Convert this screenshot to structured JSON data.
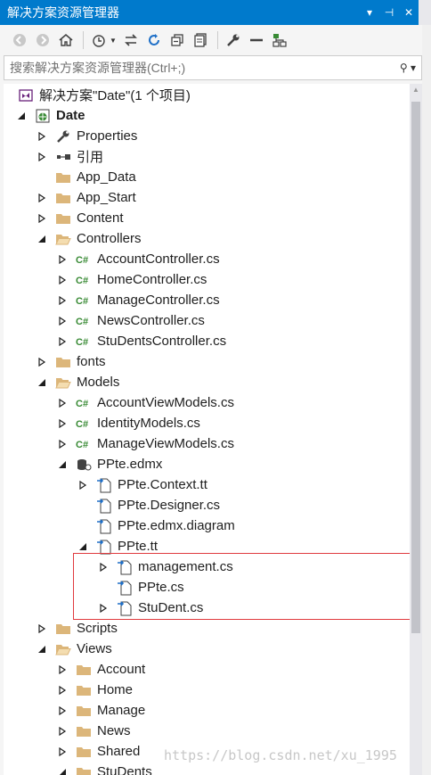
{
  "window": {
    "title": "解决方案资源管理器",
    "pin_glyph": "▾ ⊣ ✕"
  },
  "search": {
    "placeholder": "搜索解决方案资源管理器(Ctrl+;)"
  },
  "solution": {
    "label": "解决方案\"Date\"(1 个项目)"
  },
  "tree": [
    {
      "label": "Date",
      "bold": true,
      "indent": 1,
      "arrow": "open",
      "icon": "project-icon"
    },
    {
      "label": "Properties",
      "indent": 2,
      "arrow": "closed",
      "icon": "wrench-icon"
    },
    {
      "label": "引用",
      "indent": 2,
      "arrow": "closed",
      "icon": "references-icon"
    },
    {
      "label": "App_Data",
      "indent": 2,
      "arrow": "none",
      "icon": "folder-icon"
    },
    {
      "label": "App_Start",
      "indent": 2,
      "arrow": "closed",
      "icon": "folder-icon"
    },
    {
      "label": "Content",
      "indent": 2,
      "arrow": "closed",
      "icon": "folder-icon"
    },
    {
      "label": "Controllers",
      "indent": 2,
      "arrow": "open",
      "icon": "folder-open-icon"
    },
    {
      "label": "AccountController.cs",
      "indent": 3,
      "arrow": "closed",
      "icon": "csharp-icon"
    },
    {
      "label": "HomeController.cs",
      "indent": 3,
      "arrow": "closed",
      "icon": "csharp-icon"
    },
    {
      "label": "ManageController.cs",
      "indent": 3,
      "arrow": "closed",
      "icon": "csharp-icon"
    },
    {
      "label": "NewsController.cs",
      "indent": 3,
      "arrow": "closed",
      "icon": "csharp-icon"
    },
    {
      "label": "StuDentsController.cs",
      "indent": 3,
      "arrow": "closed",
      "icon": "csharp-icon"
    },
    {
      "label": "fonts",
      "indent": 2,
      "arrow": "closed",
      "icon": "folder-icon"
    },
    {
      "label": "Models",
      "indent": 2,
      "arrow": "open",
      "icon": "folder-open-icon"
    },
    {
      "label": "AccountViewModels.cs",
      "indent": 3,
      "arrow": "closed",
      "icon": "csharp-icon"
    },
    {
      "label": "IdentityModels.cs",
      "indent": 3,
      "arrow": "closed",
      "icon": "csharp-icon"
    },
    {
      "label": "ManageViewModels.cs",
      "indent": 3,
      "arrow": "closed",
      "icon": "csharp-icon"
    },
    {
      "label": "PPte.edmx",
      "indent": 3,
      "arrow": "open",
      "icon": "edmx-icon"
    },
    {
      "label": "PPte.Context.tt",
      "indent": 4,
      "arrow": "closed",
      "icon": "linked-file-icon"
    },
    {
      "label": "PPte.Designer.cs",
      "indent": 4,
      "arrow": "none",
      "icon": "linked-file-icon"
    },
    {
      "label": "PPte.edmx.diagram",
      "indent": 4,
      "arrow": "none",
      "icon": "linked-file-icon"
    },
    {
      "label": "PPte.tt",
      "indent": 4,
      "arrow": "open",
      "icon": "linked-file-icon"
    },
    {
      "label": "management.cs",
      "indent": 5,
      "arrow": "closed",
      "icon": "linked-file-icon"
    },
    {
      "label": "PPte.cs",
      "indent": 5,
      "arrow": "none",
      "icon": "linked-file-icon"
    },
    {
      "label": "StuDent.cs",
      "indent": 5,
      "arrow": "closed",
      "icon": "linked-file-icon"
    },
    {
      "label": "Scripts",
      "indent": 2,
      "arrow": "closed",
      "icon": "folder-icon"
    },
    {
      "label": "Views",
      "indent": 2,
      "arrow": "open",
      "icon": "folder-open-icon"
    },
    {
      "label": "Account",
      "indent": 3,
      "arrow": "closed",
      "icon": "folder-icon"
    },
    {
      "label": "Home",
      "indent": 3,
      "arrow": "closed",
      "icon": "folder-icon"
    },
    {
      "label": "Manage",
      "indent": 3,
      "arrow": "closed",
      "icon": "folder-icon"
    },
    {
      "label": "News",
      "indent": 3,
      "arrow": "closed",
      "icon": "folder-icon"
    },
    {
      "label": "Shared",
      "indent": 3,
      "arrow": "closed",
      "icon": "folder-icon"
    },
    {
      "label": "StuDents",
      "indent": 3,
      "arrow": "open",
      "icon": "folder-icon"
    }
  ],
  "watermark": "https://blog.csdn.net/xu_1995",
  "colors": {
    "accent": "#007acc",
    "folder": "#dcb67a",
    "csharp": "#388a34",
    "highlight": "#e03a3e"
  }
}
